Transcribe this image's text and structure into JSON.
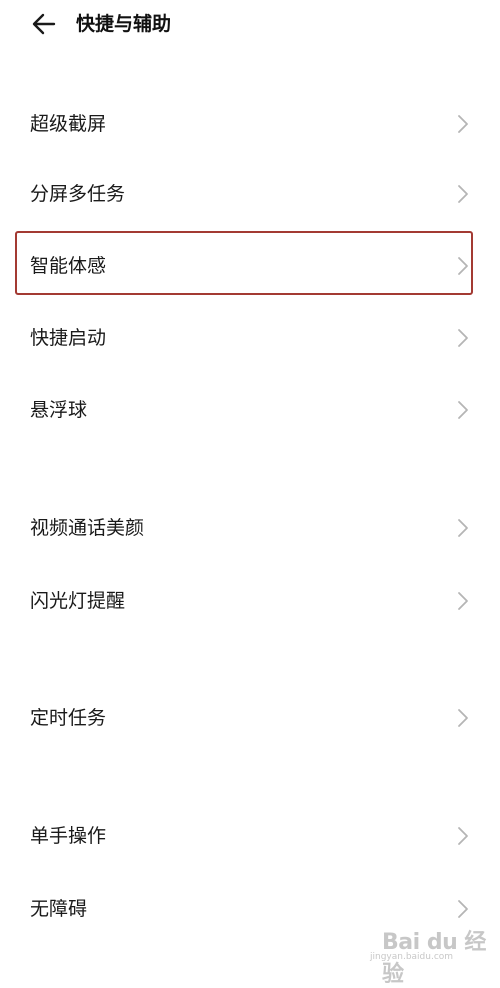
{
  "header": {
    "title": "快捷与辅助",
    "back_icon": "arrow-left-icon"
  },
  "items": [
    {
      "label": "超级截屏",
      "icon": "chevron-right-icon"
    },
    {
      "label": "分屏多任务",
      "icon": "chevron-right-icon"
    },
    {
      "label": "智能体感",
      "icon": "chevron-right-icon",
      "highlighted": true
    },
    {
      "label": "快捷启动",
      "icon": "chevron-right-icon"
    },
    {
      "label": "悬浮球",
      "icon": "chevron-right-icon"
    },
    {
      "label": "视频通话美颜",
      "icon": "chevron-right-icon"
    },
    {
      "label": "闪光灯提醒",
      "icon": "chevron-right-icon"
    },
    {
      "label": "定时任务",
      "icon": "chevron-right-icon"
    },
    {
      "label": "单手操作",
      "icon": "chevron-right-icon"
    },
    {
      "label": "无障碍",
      "icon": "chevron-right-icon"
    }
  ],
  "colors": {
    "highlight_border": "#a33a33",
    "text": "#1a1a1a",
    "chevron": "#b5b5b5"
  },
  "watermark": {
    "logo": "Bai du 经验",
    "url": "jingyan.baidu.com"
  }
}
